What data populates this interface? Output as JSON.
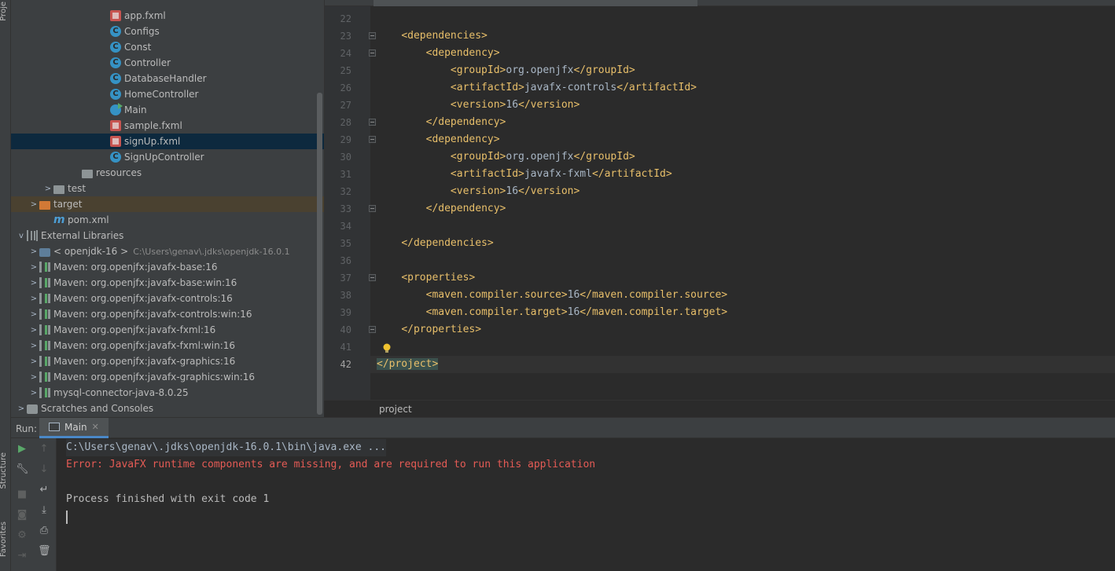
{
  "side_tabs": {
    "project": "Proje",
    "structure": "Structure",
    "favorites": "Favorites"
  },
  "tree": [
    {
      "label": "app.fxml",
      "icon": "fxml-file-icon",
      "arrow": "",
      "note": ""
    },
    {
      "label": "Configs",
      "icon": "class-icon",
      "arrow": "",
      "note": ""
    },
    {
      "label": "Const",
      "icon": "class-icon",
      "arrow": "",
      "note": ""
    },
    {
      "label": "Controller",
      "icon": "class-icon",
      "arrow": "",
      "note": ""
    },
    {
      "label": "DatabaseHandler",
      "icon": "class-icon",
      "arrow": "",
      "note": ""
    },
    {
      "label": "HomeController",
      "icon": "class-icon",
      "arrow": "",
      "note": ""
    },
    {
      "label": "Main",
      "icon": "main-class-icon",
      "arrow": "",
      "note": ""
    },
    {
      "label": "sample.fxml",
      "icon": "fxml-file-icon",
      "arrow": "",
      "note": ""
    },
    {
      "label": "signUp.fxml",
      "icon": "fxml-file-icon",
      "arrow": "",
      "note": "",
      "selected": true
    },
    {
      "label": "SignUpController",
      "icon": "class-icon",
      "arrow": "",
      "note": ""
    },
    {
      "label": "resources",
      "icon": "resources-folder-icon",
      "arrow": "",
      "note": ""
    },
    {
      "label": "test",
      "icon": "folder-icon",
      "arrow": ">",
      "note": ""
    },
    {
      "label": "target",
      "icon": "excluded-folder-icon",
      "arrow": ">",
      "note": "",
      "excluded": true
    },
    {
      "label": "pom.xml",
      "icon": "maven-file-icon",
      "arrow": "",
      "note": ""
    },
    {
      "label": "External Libraries",
      "icon": "library-icon",
      "arrow": "v",
      "note": ""
    },
    {
      "label": "< openjdk-16 >",
      "icon": "jdk-icon",
      "arrow": ">",
      "note": "C:\\Users\\genav\\.jdks\\openjdk-16.0.1"
    },
    {
      "label": "Maven: org.openjfx:javafx-base:16",
      "icon": "maven-library-icon",
      "arrow": ">",
      "note": ""
    },
    {
      "label": "Maven: org.openjfx:javafx-base:win:16",
      "icon": "maven-library-icon",
      "arrow": ">",
      "note": ""
    },
    {
      "label": "Maven: org.openjfx:javafx-controls:16",
      "icon": "maven-library-icon",
      "arrow": ">",
      "note": ""
    },
    {
      "label": "Maven: org.openjfx:javafx-controls:win:16",
      "icon": "maven-library-icon",
      "arrow": ">",
      "note": ""
    },
    {
      "label": "Maven: org.openjfx:javafx-fxml:16",
      "icon": "maven-library-icon",
      "arrow": ">",
      "note": ""
    },
    {
      "label": "Maven: org.openjfx:javafx-fxml:win:16",
      "icon": "maven-library-icon",
      "arrow": ">",
      "note": ""
    },
    {
      "label": "Maven: org.openjfx:javafx-graphics:16",
      "icon": "maven-library-icon",
      "arrow": ">",
      "note": ""
    },
    {
      "label": "Maven: org.openjfx:javafx-graphics:win:16",
      "icon": "maven-library-icon",
      "arrow": ">",
      "note": ""
    },
    {
      "label": "mysql-connector-java-8.0.25",
      "icon": "maven-library-icon",
      "arrow": ">",
      "note": ""
    },
    {
      "label": "Scratches and Consoles",
      "icon": "scratches-icon",
      "arrow": ">",
      "note": ""
    }
  ],
  "editor": {
    "lines": [
      {
        "n": "22",
        "parts": []
      },
      {
        "n": "23",
        "parts": [
          [
            "tag",
            "<dependencies>"
          ]
        ]
      },
      {
        "n": "24",
        "parts": [
          [
            "tag",
            "<dependency>"
          ]
        ]
      },
      {
        "n": "25",
        "parts": [
          [
            "tag",
            "<groupId>"
          ],
          [
            "txt",
            "org.openjfx"
          ],
          [
            "tag",
            "</groupId>"
          ]
        ]
      },
      {
        "n": "26",
        "parts": [
          [
            "tag",
            "<artifactId>"
          ],
          [
            "txt",
            "javafx-controls"
          ],
          [
            "tag",
            "</artifactId>"
          ]
        ]
      },
      {
        "n": "27",
        "parts": [
          [
            "tag",
            "<version>"
          ],
          [
            "txt",
            "16"
          ],
          [
            "tag",
            "</version>"
          ]
        ]
      },
      {
        "n": "28",
        "parts": [
          [
            "tag",
            "</dependency>"
          ]
        ]
      },
      {
        "n": "29",
        "parts": [
          [
            "tag",
            "<dependency>"
          ]
        ]
      },
      {
        "n": "30",
        "parts": [
          [
            "tag",
            "<groupId>"
          ],
          [
            "txt",
            "org.openjfx"
          ],
          [
            "tag",
            "</groupId>"
          ]
        ]
      },
      {
        "n": "31",
        "parts": [
          [
            "tag",
            "<artifactId>"
          ],
          [
            "txt",
            "javafx-fxml"
          ],
          [
            "tag",
            "</artifactId>"
          ]
        ]
      },
      {
        "n": "32",
        "parts": [
          [
            "tag",
            "<version>"
          ],
          [
            "txt",
            "16"
          ],
          [
            "tag",
            "</version>"
          ]
        ]
      },
      {
        "n": "33",
        "parts": [
          [
            "tag",
            "</dependency>"
          ]
        ]
      },
      {
        "n": "34",
        "parts": []
      },
      {
        "n": "35",
        "parts": [
          [
            "tag",
            "</dependencies>"
          ]
        ]
      },
      {
        "n": "36",
        "parts": []
      },
      {
        "n": "37",
        "parts": [
          [
            "tag",
            "<properties>"
          ]
        ]
      },
      {
        "n": "38",
        "parts": [
          [
            "tag",
            "<maven.compiler.source>"
          ],
          [
            "txt",
            "16"
          ],
          [
            "tag",
            "</maven.compiler.source>"
          ]
        ]
      },
      {
        "n": "39",
        "parts": [
          [
            "tag",
            "<maven.compiler.target>"
          ],
          [
            "txt",
            "16"
          ],
          [
            "tag",
            "</maven.compiler.target>"
          ]
        ]
      },
      {
        "n": "40",
        "parts": [
          [
            "tag",
            "</properties>"
          ]
        ]
      },
      {
        "n": "41",
        "parts": []
      },
      {
        "n": "42",
        "parts": [
          [
            "tag",
            "</project>"
          ]
        ]
      }
    ],
    "breadcrumb": "project"
  },
  "run": {
    "label": "Run:",
    "tab": "Main",
    "console": {
      "cmd": "C:\\Users\\genav\\.jdks\\openjdk-16.0.1\\bin\\java.exe ...",
      "error": "Error: JavaFX runtime components are missing, and are required to run this application",
      "exit": "Process finished with exit code 1"
    }
  },
  "colors": {
    "tag": "#e8bf6a",
    "text": "#a9b7c6",
    "error": "#e55b55",
    "selection": "#0d293e",
    "accent": "#4a88c7"
  }
}
